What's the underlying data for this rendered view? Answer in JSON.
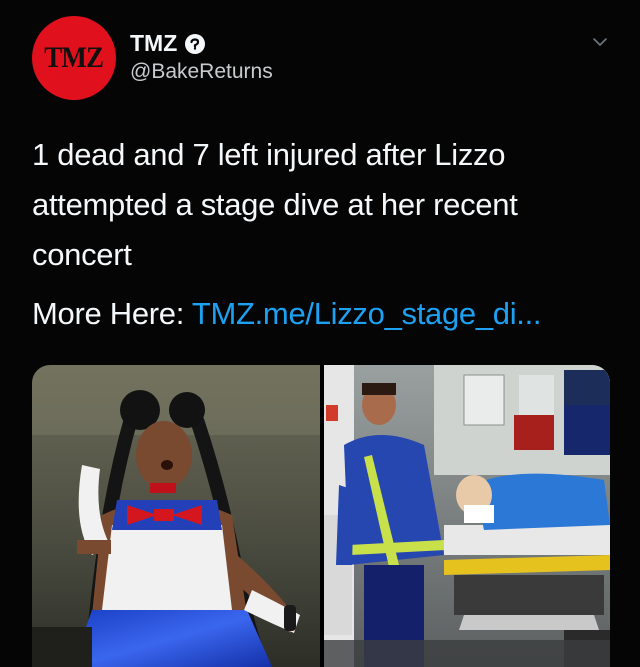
{
  "account": {
    "avatar_text": "TMZ",
    "display_name": "TMZ",
    "handle": "@BakeReturns",
    "avatar_color": "#e0101c",
    "verified_icon": "verified-badge-icon"
  },
  "tweet": {
    "text": "1 dead and 7 left injured after Lizzo attempted a stage dive at her recent concert",
    "more_label": "More Here:",
    "link_text": "TMZ.me/Lizzo_stage_di...",
    "link_color": "#1da1f2"
  },
  "menu": {
    "icon": "chevron-down-icon"
  },
  "media": {
    "photos": [
      {
        "name": "performer-photo"
      },
      {
        "name": "stretcher-photo"
      }
    ]
  }
}
